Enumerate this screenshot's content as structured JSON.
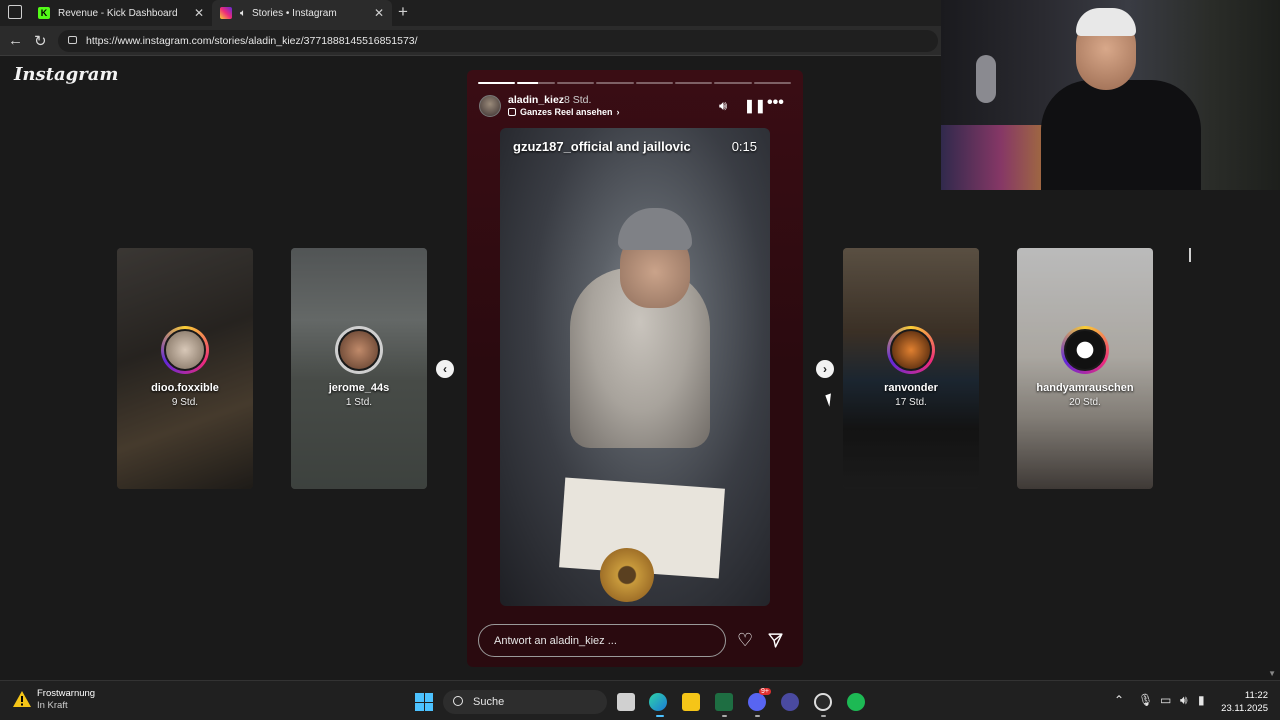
{
  "browser": {
    "tabs": [
      {
        "title": "Revenue - Kick Dashboard",
        "favicon": "kick-icon"
      },
      {
        "title": "Stories • Instagram",
        "favicon": "instagram-icon",
        "active": true
      }
    ],
    "url": "https://www.instagram.com/stories/aladin_kiez/3771888145516851573/"
  },
  "instagram": {
    "logo": "Instagram",
    "previews_left": [
      {
        "username": "dioo.foxxible",
        "time": "9 Std."
      },
      {
        "username": "jerome_44s",
        "time": "1 Std."
      }
    ],
    "previews_right": [
      {
        "username": "ranvonder",
        "time": "17 Std."
      },
      {
        "username": "handyamrauschen",
        "time": "20 Std."
      }
    ],
    "story": {
      "username": "aladin_kiez",
      "time": "8 Std.",
      "reel_link": "Ganzes Reel ansehen",
      "caption": "gzuz187_official and jaillovic",
      "duration": "0:15",
      "segments_total": 8,
      "segments_done": 1,
      "reply_placeholder": "Antwort an aladin_kiez ..."
    }
  },
  "taskbar": {
    "weather_title": "Frostwarnung",
    "weather_sub": "In Kraft",
    "search_label": "Suche",
    "time": "11:22",
    "date": "23.11.2025",
    "discord_badge": "9+"
  },
  "colors": {
    "accent_blue": "#4cc2ff",
    "story_bg": "#2a0a0f",
    "kick_green": "#53fc18"
  }
}
